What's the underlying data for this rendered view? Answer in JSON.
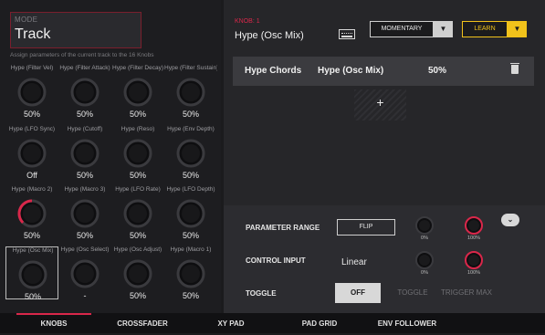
{
  "mode": {
    "label": "MODE",
    "value": "Track"
  },
  "assign_text": "Assign parameters of the current track to the 16 Knobs",
  "knobs": [
    {
      "label": "Hype (Filter Vel)",
      "value": "50%",
      "level": 0.5
    },
    {
      "label": "Hype (Filter Attack)",
      "value": "50%",
      "level": 0.5
    },
    {
      "label": "Hype (Filter Decay)",
      "value": "50%",
      "level": 0.5
    },
    {
      "label": "Hype (Filter Sustain)",
      "value": "50%",
      "level": 0.5
    },
    {
      "label": "Hype (LFO Sync)",
      "value": "Off",
      "level": 0.5
    },
    {
      "label": "Hype (Cutoff)",
      "value": "50%",
      "level": 0.5
    },
    {
      "label": "Hype (Reso)",
      "value": "50%",
      "level": 0.5
    },
    {
      "label": "Hype (Env Depth)",
      "value": "50%",
      "level": 0.5
    },
    {
      "label": "Hype (Macro 2)",
      "value": "50%",
      "level": 0.5,
      "active": true
    },
    {
      "label": "Hype (Macro 3)",
      "value": "50%",
      "level": 0.5
    },
    {
      "label": "Hype (LFO Rate)",
      "value": "50%",
      "level": 0.5
    },
    {
      "label": "Hype (LFO Depth)",
      "value": "50%",
      "level": 0.5
    },
    {
      "label": "Hype (Osc Mix)",
      "value": "50%",
      "level": 0.5,
      "selected": true
    },
    {
      "label": "Hype (Osc Select)",
      "value": "-",
      "level": 0.5
    },
    {
      "label": "Hype (Osc Adjust)",
      "value": "50%",
      "level": 0.5
    },
    {
      "label": "Hype (Macro 1)",
      "value": "50%",
      "level": 0.5
    }
  ],
  "detail": {
    "knob_number": "KNOB: 1",
    "knob_name": "Hype (Osc Mix)",
    "keyboard_icon": "keyboard-icon",
    "momentary_label": "MOMENTARY",
    "learn_label": "LEARN",
    "target": {
      "track": "Hype Chords",
      "param": "Hype (Osc Mix)",
      "value": "50%"
    },
    "add_label": "+"
  },
  "settings": {
    "parameter_range_label": "PARAMETER RANGE",
    "flip_label": "FLIP",
    "range_min": "0%",
    "range_max": "100%",
    "control_input_label": "CONTROL INPUT",
    "control_input_value": "Linear",
    "ci_min": "0%",
    "ci_max": "100%",
    "toggle_label": "TOGGLE",
    "toggle_options": [
      "OFF",
      "TOGGLE",
      "TRIGGER MAX"
    ]
  },
  "tabs": [
    "KNOBS",
    "CROSSFADER",
    "XY PAD",
    "PAD GRID",
    "ENV FOLLOWER"
  ],
  "colors": {
    "accent": "#d9274a",
    "learn": "#f1c21b"
  }
}
